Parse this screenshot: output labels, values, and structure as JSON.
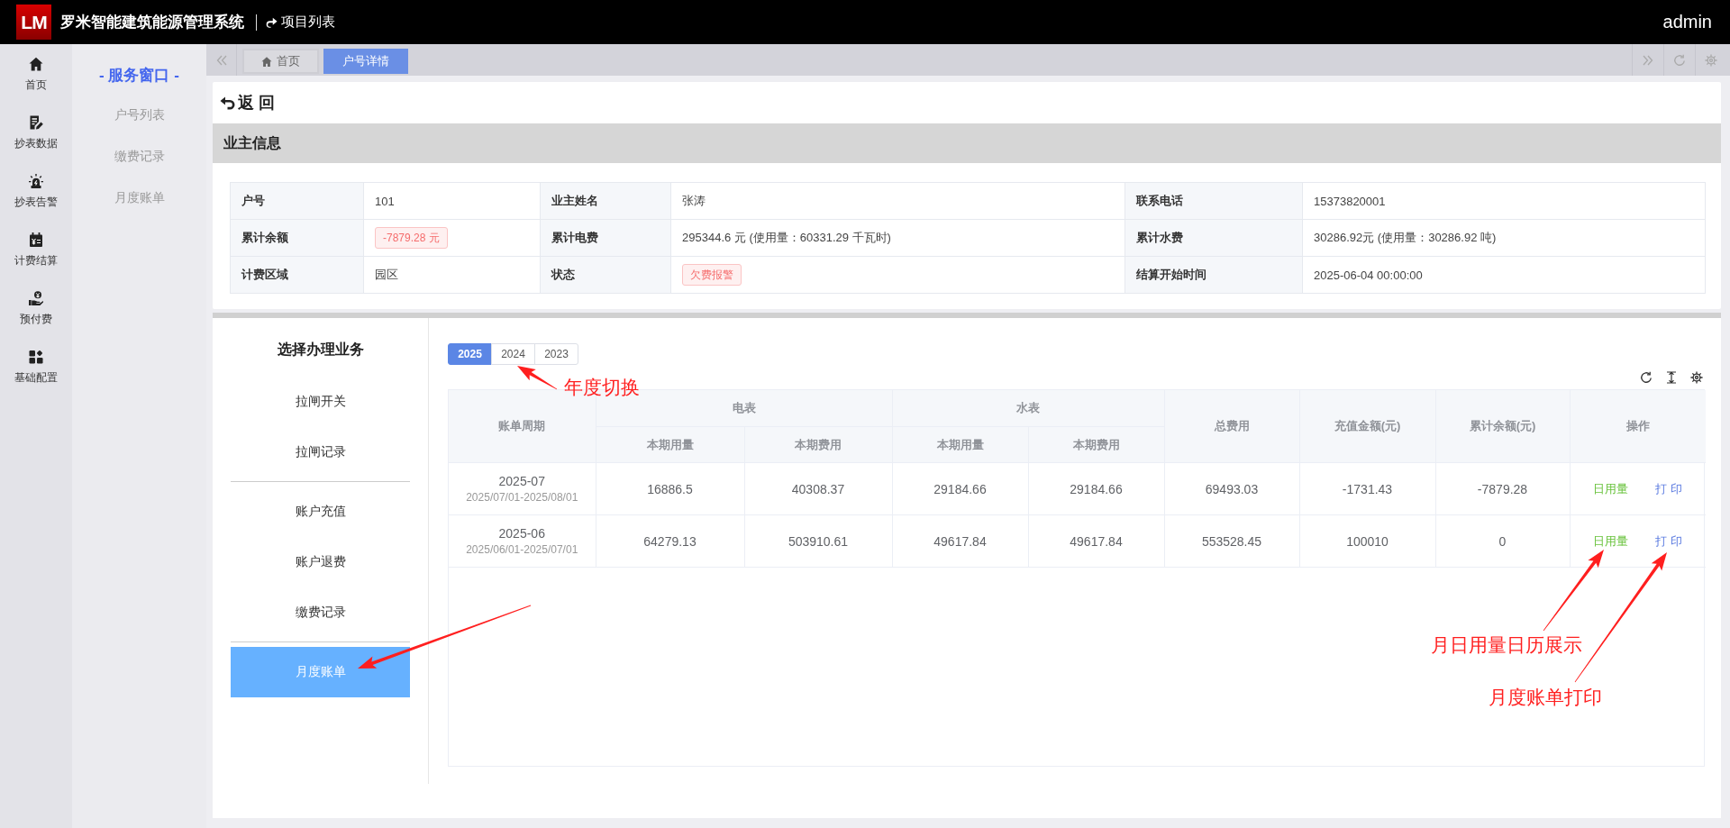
{
  "header": {
    "logo": "LM",
    "title": "罗米智能建筑能源管理系统",
    "project_link": "项目列表",
    "user": "admin"
  },
  "nav": [
    {
      "label": "首页"
    },
    {
      "label": "抄表数据"
    },
    {
      "label": "抄表告警"
    },
    {
      "label": "计费结算"
    },
    {
      "label": "预付费"
    },
    {
      "label": "基础配置"
    }
  ],
  "service_menu": {
    "title": "- 服务窗口 -",
    "items": [
      "户号列表",
      "缴费记录",
      "月度账单"
    ]
  },
  "tabs": [
    {
      "label": "首页",
      "selected": false
    },
    {
      "label": "户号详情",
      "selected": true
    }
  ],
  "back_button": "返 回",
  "owner_info": {
    "title": "业主信息",
    "fields": [
      {
        "label": "户号",
        "value": "101",
        "kind": "text"
      },
      {
        "label": "业主姓名",
        "value": "张涛",
        "kind": "text"
      },
      {
        "label": "联系电话",
        "value": "15373820001",
        "kind": "text"
      },
      {
        "label": "累计余额",
        "value": "-7879.28 元",
        "kind": "tag"
      },
      {
        "label": "累计电费",
        "value": "295344.6 元 (使用量：60331.29 千瓦时)",
        "kind": "text"
      },
      {
        "label": "累计水费",
        "value": "30286.92元 (使用量：30286.92 吨)",
        "kind": "text"
      },
      {
        "label": "计费区域",
        "value": "园区",
        "kind": "text"
      },
      {
        "label": "状态",
        "value": "欠费报警",
        "kind": "tag"
      },
      {
        "label": "结算开始时间",
        "value": "2025-06-04 00:00:00",
        "kind": "text"
      }
    ]
  },
  "business_menu": {
    "title": "选择办理业务",
    "groups": [
      {
        "items": [
          {
            "label": "拉闸开关",
            "selected": false
          },
          {
            "label": "拉闸记录",
            "selected": false
          }
        ]
      },
      {
        "items": [
          {
            "label": "账户充值",
            "selected": false
          },
          {
            "label": "账户退费",
            "selected": false
          },
          {
            "label": "缴费记录",
            "selected": false
          }
        ]
      },
      {
        "items": [
          {
            "label": "月度账单",
            "selected": true
          }
        ]
      }
    ]
  },
  "years": [
    {
      "label": "2025",
      "selected": true
    },
    {
      "label": "2024",
      "selected": false
    },
    {
      "label": "2023",
      "selected": false
    }
  ],
  "bill_table": {
    "columns": [
      {
        "label": "账单周期"
      },
      {
        "label": "电表",
        "children": [
          "本期用量",
          "本期费用"
        ]
      },
      {
        "label": "水表",
        "children": [
          "本期用量",
          "本期费用"
        ]
      },
      {
        "label": "总费用"
      },
      {
        "label": "充值金额(元)"
      },
      {
        "label": "累计余额(元)"
      },
      {
        "label": "操作"
      }
    ],
    "rows": [
      {
        "period": "2025-07",
        "range": "2025/07/01-2025/08/01",
        "values": [
          "16886.5",
          "40308.37",
          "29184.66",
          "29184.66",
          "69493.03",
          "-1731.43",
          "-7879.28"
        ],
        "actions": [
          {
            "label": "日用量",
            "color": "#67c23a"
          },
          {
            "label": "打 印",
            "color": "#5b7be0"
          }
        ]
      },
      {
        "period": "2025-06",
        "range": "2025/06/01-2025/07/01",
        "values": [
          "64279.13",
          "503910.61",
          "49617.84",
          "49617.84",
          "553528.45",
          "100010",
          "0"
        ],
        "actions": [
          {
            "label": "日用量",
            "color": "#67c23a"
          },
          {
            "label": "打 印",
            "color": "#5b7be0"
          }
        ]
      }
    ]
  },
  "annotations": [
    {
      "text": "年度切换"
    },
    {
      "text": "月日用量日历展示"
    },
    {
      "text": "月度账单打印"
    }
  ]
}
